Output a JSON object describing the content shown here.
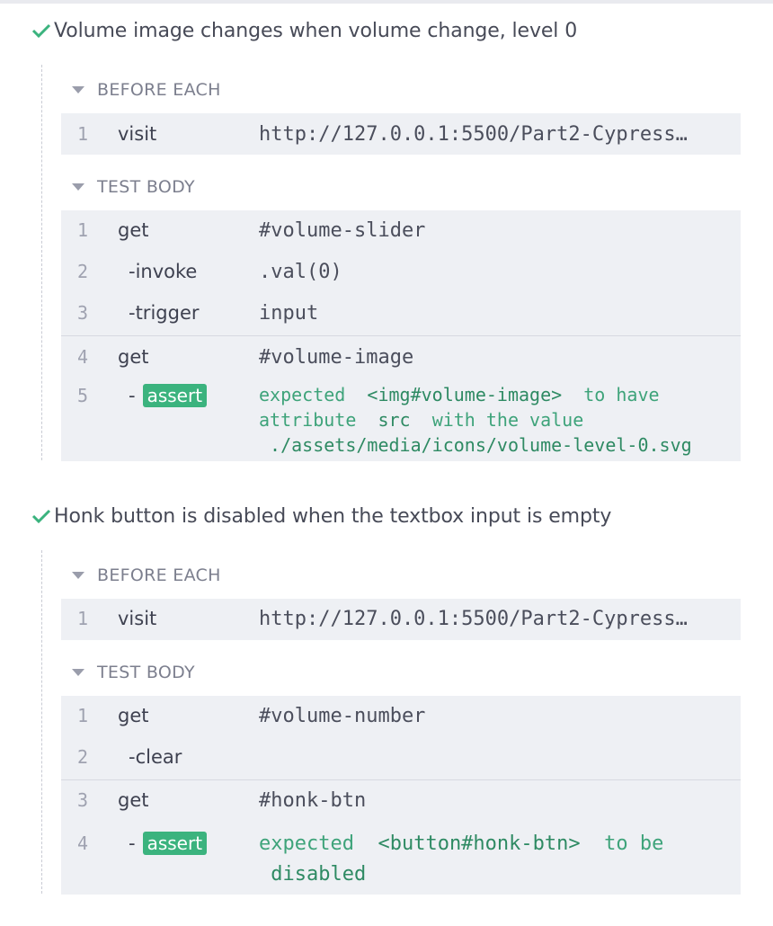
{
  "tests": [
    {
      "title": "Volume image changes when volume change, level 0",
      "before_each": {
        "label": "BEFORE EACH",
        "commands": [
          {
            "num": "1",
            "name": "visit",
            "message": "http://127.0.0.1:5500/Part2-Cypress…"
          }
        ]
      },
      "test_body": {
        "label": "TEST BODY",
        "commands": [
          {
            "num": "1",
            "name": "get",
            "message": "#volume-slider"
          },
          {
            "num": "2",
            "name": "-invoke",
            "message": ".val(0)"
          },
          {
            "num": "3",
            "name": "-trigger",
            "message": "input"
          },
          {
            "num": "4",
            "name": "get",
            "message": "#volume-image"
          },
          {
            "num": "5",
            "name": "-",
            "badge": "assert",
            "assertion": {
              "w1": "expected",
              "subject": "<img#volume-image>",
              "w2": "to have",
              "w3": "attribute",
              "attr": "src",
              "w4": "with the value",
              "value": "./assets/media/icons/volume-level-0.svg"
            }
          }
        ]
      }
    },
    {
      "title": "Honk button is disabled when the textbox input is empty",
      "before_each": {
        "label": "BEFORE EACH",
        "commands": [
          {
            "num": "1",
            "name": "visit",
            "message": "http://127.0.0.1:5500/Part2-Cypress…"
          }
        ]
      },
      "test_body": {
        "label": "TEST BODY",
        "commands": [
          {
            "num": "1",
            "name": "get",
            "message": "#volume-number"
          },
          {
            "num": "2",
            "name": "-clear",
            "message": ""
          },
          {
            "num": "3",
            "name": "get",
            "message": "#honk-btn"
          },
          {
            "num": "4",
            "name": "-",
            "badge": "assert",
            "assertion": {
              "w1": "expected",
              "subject": "<button#honk-btn>",
              "w2": "to be",
              "value": "disabled"
            }
          }
        ]
      }
    }
  ],
  "colors": {
    "pass": "#3bb37e",
    "block_bg": "#eef0f4"
  },
  "icons": {
    "pass": "check-icon",
    "collapse": "caret-down-icon"
  }
}
